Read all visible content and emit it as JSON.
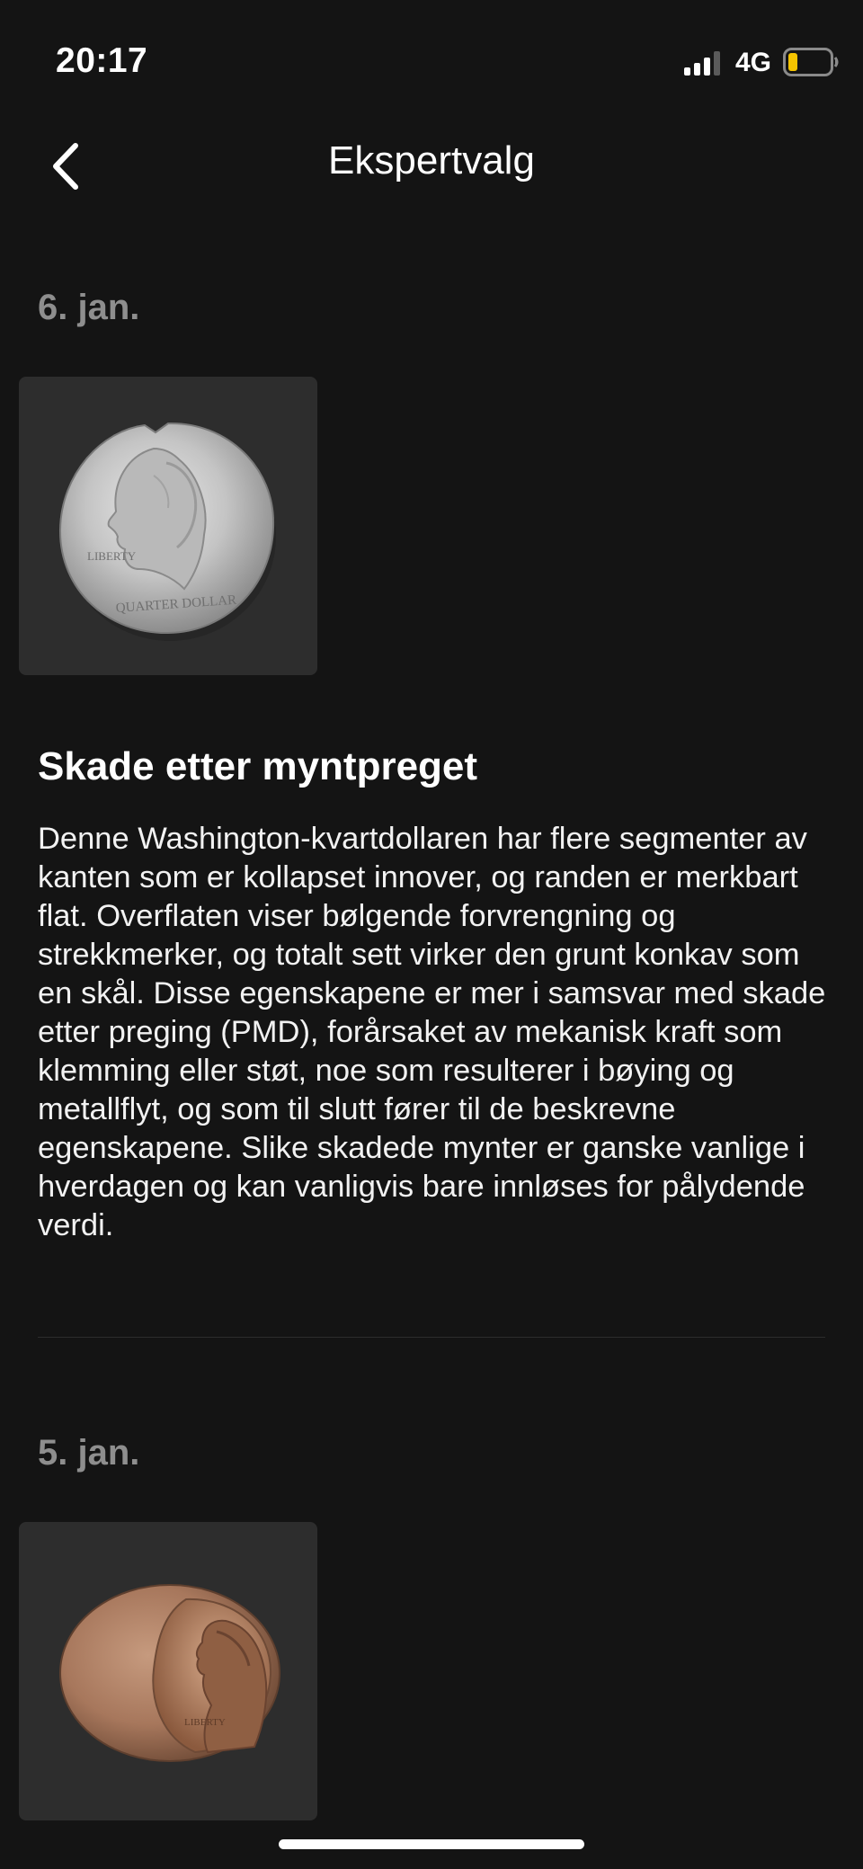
{
  "status_bar": {
    "time": "20:17",
    "network": "4G",
    "icons": [
      "cellular-signal-icon",
      "battery-low-icon"
    ],
    "battery_color": "#f5c400"
  },
  "nav": {
    "back_icon": "chevron-left-icon",
    "title": "Ekspertvalg"
  },
  "entries": [
    {
      "date": "6. jan.",
      "image": "worn-washington-quarter-coin",
      "image_text": [
        "LIBERTY",
        "QUARTER DOLLAR"
      ],
      "title": "Skade etter myntpreget",
      "description": "Denne Washington-kvartdollaren har flere segmenter av kanten som er kollapset innover, og randen er merkbart flat. Overflaten viser bølgende forvrengning og strekkmerker, og totalt sett virker den grunt konkav som en skål. Disse egenskapene er mer i samsvar med skade etter preging (PMD), forårsaket av mekanisk kraft som klemming eller støt, noe som resulterer i bøying og metallflyt, og som til slutt fører til de beskrevne egenskapene. Slike skadede mynter er ganske vanlige i hverdagen og kan vanligvis bare innløses for pålydende verdi."
    },
    {
      "date": "5. jan.",
      "image": "off-center-lincoln-cent-coin",
      "image_text": [
        "LIBERTY"
      ]
    }
  ],
  "colors": {
    "background": "#141414",
    "card": "#2d2d2d",
    "date_text": "#8e8e8e",
    "divider": "#2c2c2c"
  }
}
